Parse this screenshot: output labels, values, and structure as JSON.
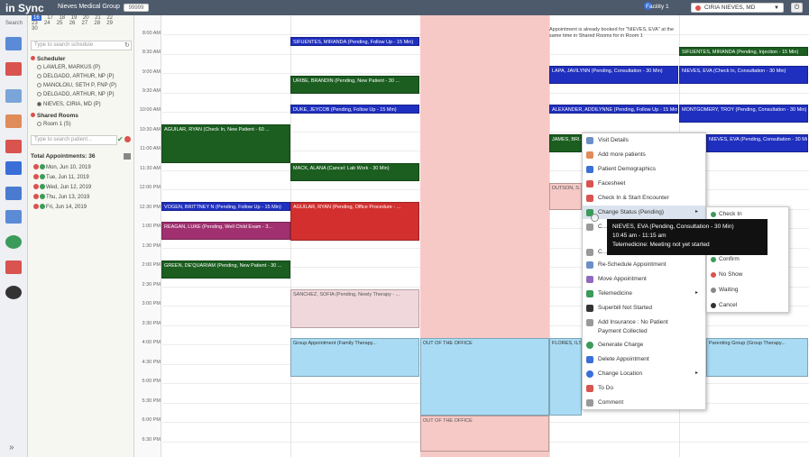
{
  "header": {
    "logo": "in Sync",
    "org": "Nieves Medical Group",
    "org_badge": "99999",
    "facility": "Facility 1",
    "user": "CIRIA NIEVES, MD"
  },
  "leftbar": {
    "search_label": "Search",
    "icons": [
      "monitor-icon",
      "globe-icon",
      "calendar-icon",
      "doctor-icon",
      "chart-icon",
      "billing-icon",
      "reports-icon",
      "settings-icon",
      "mu-icon",
      "cloud-icon",
      "network-icon"
    ],
    "expand": "»"
  },
  "calendar": {
    "rows": [
      [
        "16",
        "17",
        "18",
        "19",
        "20",
        "21",
        "22"
      ],
      [
        "23",
        "24",
        "25",
        "26",
        "27",
        "28",
        "29"
      ],
      [
        "30",
        "",
        "",
        "",
        "",
        "",
        ""
      ]
    ]
  },
  "schedule_search": {
    "placeholder": "Type to search schedule"
  },
  "scheduler": {
    "title": "Scheduler",
    "items": [
      {
        "label": "LAWLER, MARKUS (P)",
        "selected": false
      },
      {
        "label": "DELGADO, ARTHUR, NP (P)",
        "selected": false
      },
      {
        "label": "MANOLOIU, SETH P, FNP (P)",
        "selected": false
      },
      {
        "label": "DELGADO, ARTHUR, NP (P)",
        "selected": false
      },
      {
        "label": "NIEVES, CIRIA, MD (P)",
        "selected": true
      }
    ]
  },
  "shared_rooms": {
    "title": "Shared Rooms",
    "items": [
      {
        "label": "Room 1 (S)"
      }
    ]
  },
  "patient_search": {
    "placeholder": "Type to search patient..."
  },
  "appointments": {
    "title": "Total Appointments: 36",
    "days": [
      "Mon, Jun 10, 2019",
      "Tue, Jun 11, 2019",
      "Wed, Jun 12, 2019",
      "Thu, Jun 13, 2019",
      "Fri, Jun 14, 2019"
    ]
  },
  "times": [
    "8:00 AM",
    "8:30 AM",
    "9:00 AM",
    "9:30 AM",
    "10:00 AM",
    "10:30 AM",
    "11:00 AM",
    "11:30 AM",
    "12:00 PM",
    "12:30 PM",
    "1:00 PM",
    "1:30 PM",
    "2:00 PM",
    "2:30 PM",
    "3:00 PM",
    "3:30 PM",
    "4:00 PM",
    "4:30 PM",
    "5:00 PM",
    "5:30 PM",
    "6:00 PM",
    "6:30 PM"
  ],
  "appts": {
    "a1": "SIFUENTES, MIRANDA (Pending, Follow Up - 15 Min)",
    "a2": "URIBE, BRANDIN (Pending, New Patient - 30 ...",
    "a3": "DUKE, JEYCOB (Pending, Follow Up - 15 Min)",
    "a4": "AGUILAR, RYAN (Check In, New Patient - 60 ...",
    "a5": "MACK, ALANA (Cancel: Lab Work - 30 Min)",
    "a6": "VOGEN, BRITTNEY N (Pending, Follow Up - 15 Min)",
    "a7": "AGUILAR, RYAN (Pending, Office Procedure - ...",
    "a8": "REAGAN, LUKE (Pending, Well Child Exam - 3...",
    "a9": "GREEN, DE'QUARIAM (Pending, New Patient - 30 ...",
    "a10": "SANCHEZ, SOFIA (Pending, Newly Therapy - ...",
    "a11": "Group Appointment (Family Therapy...",
    "a12": "OUT OF THE OFFICE",
    "a13": "OUT OF THE OFFICE",
    "a14": "SIFUENTES, MIRANDA (Pending, Injection - 15 Min)",
    "a15": "LAPA, JAVILYNN (Pending, Consultation - 30 Min)",
    "a16": "NIEVES, EVA (Check In, Consultation - 30 Min)",
    "a17": "ALEXANDER, ADDILYNNE (Pending, Follow Up - 15 Min)",
    "a18": "MONTGOMERY, TROY (Pending, Consultation - 30 Min)",
    "a19": "JAMES, BRI...",
    "a20": "NIEVES, EVA (Pending, Consultation - 30 Min)",
    "a21": "DUTSON, S...",
    "a22": "FLORES, ILS...",
    "a23": "Parenting Group (Group Therapy...",
    "note": "Appointment is already booked for \"NIEVES, EVA\" at the same time in Shared Rooms for in Room 1"
  },
  "context_menu": {
    "items": [
      "Visit Details",
      "Add more patients",
      "Patient Demographics",
      "Facesheet",
      "Check In & Start Encounter",
      "Change Status (Pending)",
      "C...",
      "C...",
      "Re-Schedule Appointment",
      "Move Appointment",
      "Telemedicine",
      "Superbill Not Started",
      "Add Insurance : No Patient Payment Collected",
      "Generate Charge",
      "Delete Appointment",
      "Change Location",
      "To Do",
      "Comment"
    ]
  },
  "status_submenu": {
    "items": [
      "Check In",
      "Confirm",
      "No Show",
      "Waiting",
      "Cancel"
    ]
  },
  "tooltip": {
    "line1": "NIEVES, EVA (Pending, Consultation - 30 Min)",
    "line2": "10:45 am - 11:15 am",
    "line3": "Telemedicine: Meeting not yet started"
  }
}
